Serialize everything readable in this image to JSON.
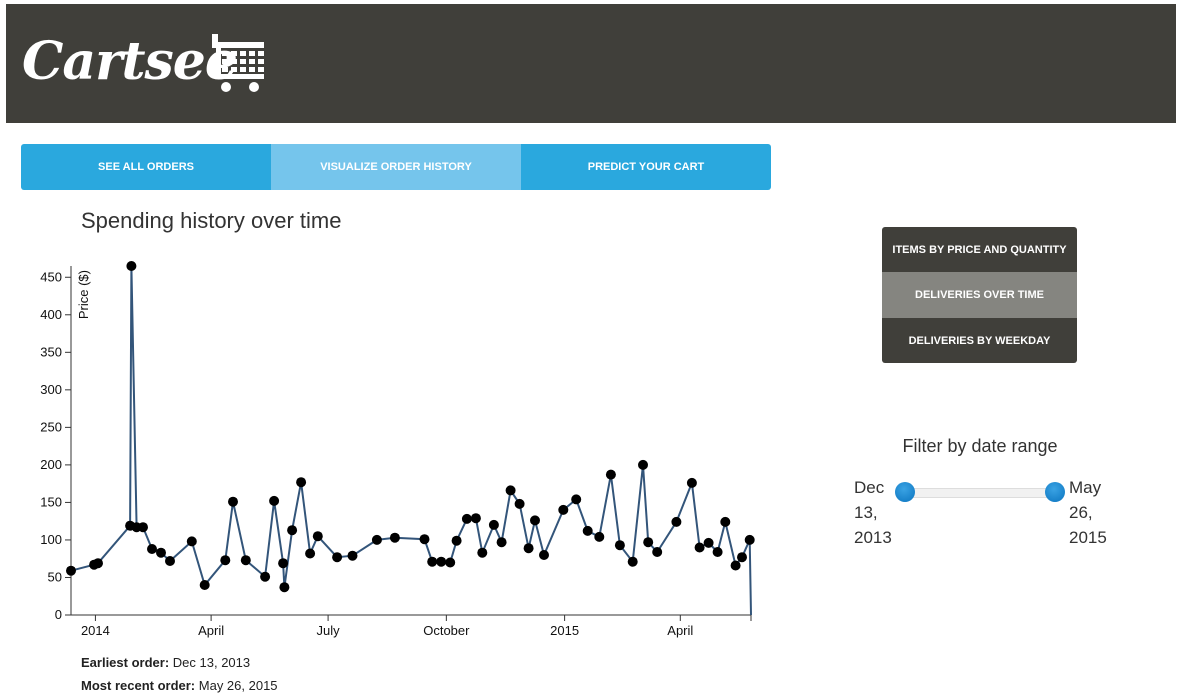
{
  "header": {
    "brand": "Cartsee"
  },
  "tabs": [
    {
      "label": "SEE ALL ORDERS"
    },
    {
      "label": "VISUALIZE ORDER HISTORY"
    },
    {
      "label": "PREDICT YOUR CART"
    }
  ],
  "viz_menu": [
    {
      "label": "ITEMS BY PRICE AND QUANTITY"
    },
    {
      "label": "DELIVERIES OVER TIME"
    },
    {
      "label": "DELIVERIES BY WEEKDAY"
    }
  ],
  "filter": {
    "title": "Filter by date range",
    "start_month": "Dec",
    "start_day": "13,",
    "start_year": "2013",
    "end_month": "May",
    "end_day": "26,",
    "end_year": "2015"
  },
  "summary": {
    "earliest_label": "Earliest order:",
    "earliest_value": "Dec 13, 2013",
    "recent_label": "Most recent order:",
    "recent_value": "May 26, 2015"
  },
  "chart_data": {
    "type": "line",
    "title": "Spending history over time",
    "ylabel": "Price ($)",
    "xlabel": "",
    "ylim": [
      0,
      465
    ],
    "xlim": [
      "2013-12-13",
      "2015-05-26"
    ],
    "y_ticks": [
      0,
      50,
      100,
      150,
      200,
      250,
      300,
      350,
      400,
      450
    ],
    "x_ticks": [
      {
        "date": "2014-01-01",
        "label": "2014"
      },
      {
        "date": "2014-04-01",
        "label": "April"
      },
      {
        "date": "2014-07-01",
        "label": "July"
      },
      {
        "date": "2014-10-01",
        "label": "October"
      },
      {
        "date": "2015-01-01",
        "label": "2015"
      },
      {
        "date": "2015-04-01",
        "label": "April"
      }
    ],
    "grid": false,
    "series": [
      {
        "color": "#33557a",
        "points": [
          {
            "x": "2013-12-13",
            "y": 59
          },
          {
            "x": "2013-12-31",
            "y": 67
          },
          {
            "x": "2014-01-03",
            "y": 69
          },
          {
            "x": "2014-01-28",
            "y": 119
          },
          {
            "x": "2014-01-29",
            "y": 465
          },
          {
            "x": "2014-02-02",
            "y": 117
          },
          {
            "x": "2014-02-07",
            "y": 117
          },
          {
            "x": "2014-02-14",
            "y": 88
          },
          {
            "x": "2014-02-21",
            "y": 83
          },
          {
            "x": "2014-02-28",
            "y": 72
          },
          {
            "x": "2014-03-17",
            "y": 98
          },
          {
            "x": "2014-03-27",
            "y": 40
          },
          {
            "x": "2014-04-12",
            "y": 73
          },
          {
            "x": "2014-04-18",
            "y": 151
          },
          {
            "x": "2014-04-28",
            "y": 73
          },
          {
            "x": "2014-05-13",
            "y": 51
          },
          {
            "x": "2014-05-20",
            "y": 152
          },
          {
            "x": "2014-05-27",
            "y": 69
          },
          {
            "x": "2014-05-28",
            "y": 37
          },
          {
            "x": "2014-06-03",
            "y": 113
          },
          {
            "x": "2014-06-10",
            "y": 177
          },
          {
            "x": "2014-06-17",
            "y": 82
          },
          {
            "x": "2014-06-23",
            "y": 105
          },
          {
            "x": "2014-07-08",
            "y": 77
          },
          {
            "x": "2014-07-20",
            "y": 79
          },
          {
            "x": "2014-08-08",
            "y": 100
          },
          {
            "x": "2014-08-22",
            "y": 103
          },
          {
            "x": "2014-09-14",
            "y": 101
          },
          {
            "x": "2014-09-20",
            "y": 71
          },
          {
            "x": "2014-09-27",
            "y": 71
          },
          {
            "x": "2014-10-04",
            "y": 70
          },
          {
            "x": "2014-10-09",
            "y": 99
          },
          {
            "x": "2014-10-17",
            "y": 128
          },
          {
            "x": "2014-10-24",
            "y": 129
          },
          {
            "x": "2014-10-29",
            "y": 83
          },
          {
            "x": "2014-11-07",
            "y": 120
          },
          {
            "x": "2014-11-13",
            "y": 97
          },
          {
            "x": "2014-11-20",
            "y": 166
          },
          {
            "x": "2014-11-27",
            "y": 148
          },
          {
            "x": "2014-12-04",
            "y": 89
          },
          {
            "x": "2014-12-09",
            "y": 126
          },
          {
            "x": "2014-12-16",
            "y": 80
          },
          {
            "x": "2014-12-31",
            "y": 140
          },
          {
            "x": "2015-01-10",
            "y": 154
          },
          {
            "x": "2015-01-19",
            "y": 112
          },
          {
            "x": "2015-01-28",
            "y": 104
          },
          {
            "x": "2015-02-06",
            "y": 187
          },
          {
            "x": "2015-02-13",
            "y": 93
          },
          {
            "x": "2015-02-23",
            "y": 71
          },
          {
            "x": "2015-03-03",
            "y": 200
          },
          {
            "x": "2015-03-07",
            "y": 97
          },
          {
            "x": "2015-03-14",
            "y": 84
          },
          {
            "x": "2015-03-29",
            "y": 124
          },
          {
            "x": "2015-04-10",
            "y": 176
          },
          {
            "x": "2015-04-16",
            "y": 90
          },
          {
            "x": "2015-04-23",
            "y": 96
          },
          {
            "x": "2015-04-30",
            "y": 84
          },
          {
            "x": "2015-05-06",
            "y": 124
          },
          {
            "x": "2015-05-14",
            "y": 66
          },
          {
            "x": "2015-05-19",
            "y": 77
          },
          {
            "x": "2015-05-25",
            "y": 100
          },
          {
            "x": "2015-05-26",
            "y": 0
          }
        ]
      }
    ]
  }
}
